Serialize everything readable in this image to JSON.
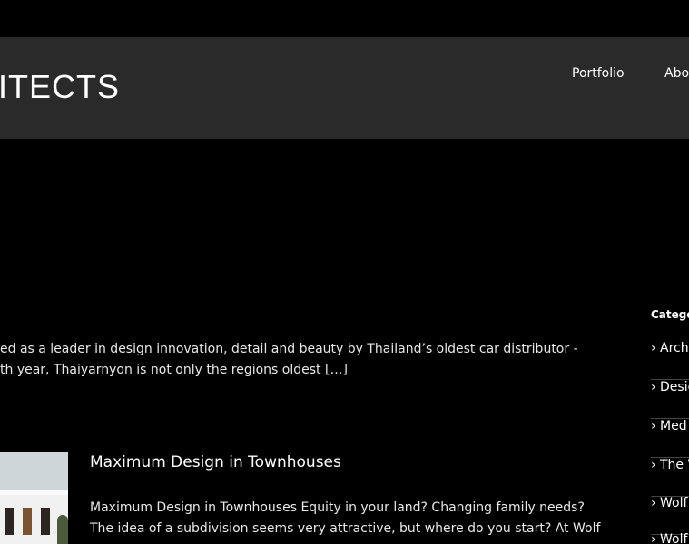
{
  "header": {
    "logo_text": "ITECTS",
    "nav": {
      "portfolio": "Portfolio",
      "about": "Abo"
    }
  },
  "excerpt": {
    "line1": "ed as a leader in design innovation, detail and beauty by Thailand’s oldest car distributor -",
    "line2": "th year, Thaiyarnyon is not only the regions oldest ",
    "read_more": "[…]"
  },
  "post": {
    "title": "Maximum Design in Townhouses",
    "body_line1": "Maximum Design in Townhouses   Equity in your land? Changing family needs?",
    "body_line2": "The idea of a subdivision seems very attractive, but where do you start? At Wolf"
  },
  "sidebar": {
    "title": "Catego",
    "categories": [
      "Arch",
      "Desig",
      "Med",
      "The W",
      "Wolf",
      "Wolf"
    ]
  },
  "colors": {
    "background": "#000000",
    "header_bg": "#2a2a2a",
    "text": "#ffffff",
    "divider": "#444444"
  }
}
